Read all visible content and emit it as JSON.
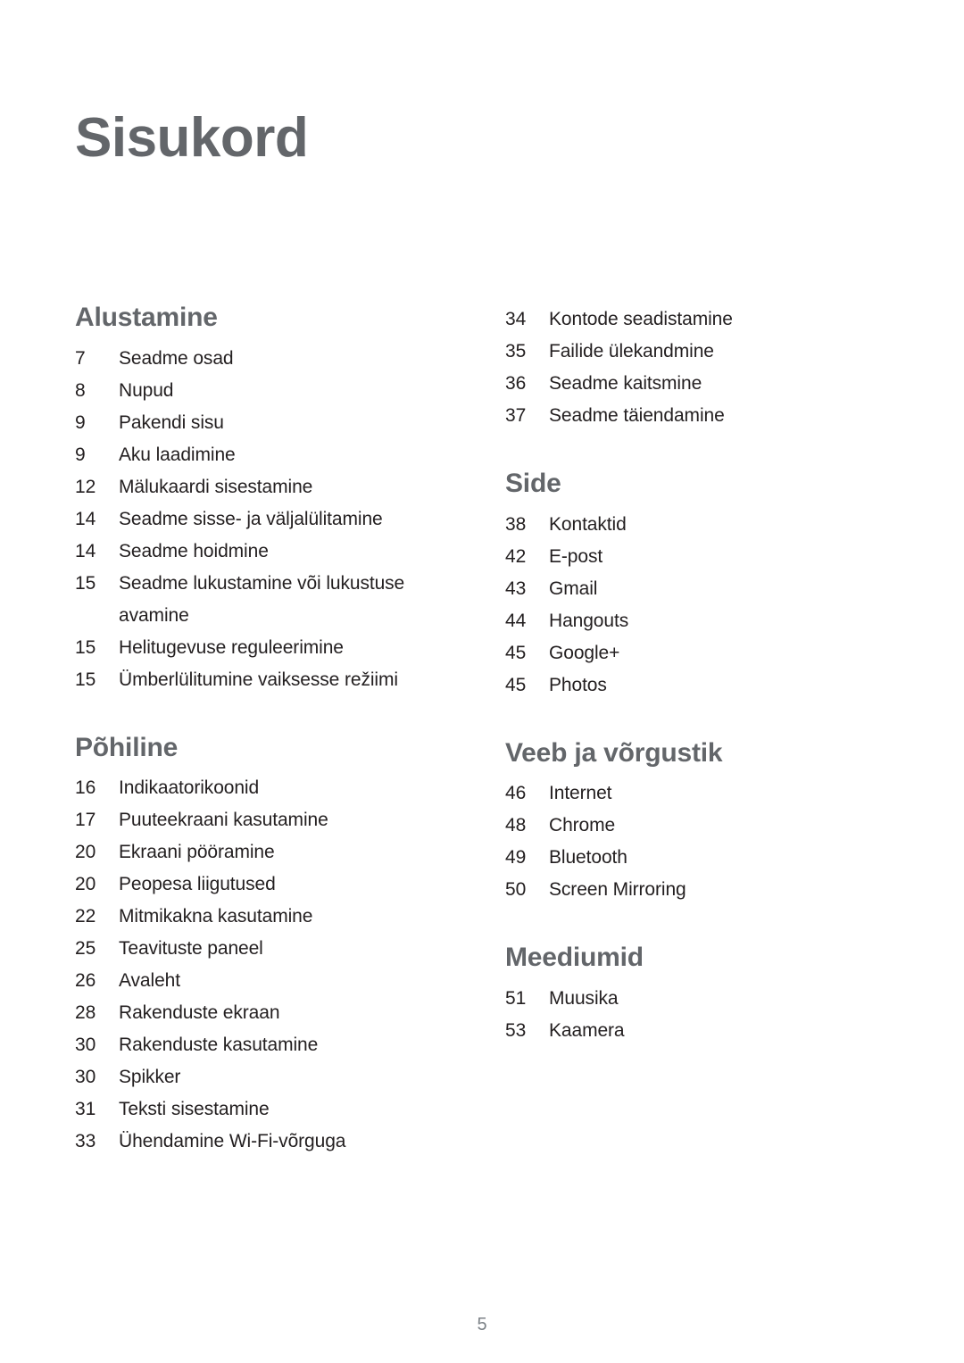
{
  "document": {
    "title": "Sisukord",
    "page_number": "5"
  },
  "colors": {
    "heading": "#63666a",
    "body_text": "#231f20",
    "folio": "#7c8287",
    "background": "#ffffff"
  },
  "columns": {
    "left": [
      {
        "heading": "Alustamine",
        "entries": [
          {
            "page": "7",
            "label": "Seadme osad"
          },
          {
            "page": "8",
            "label": "Nupud"
          },
          {
            "page": "9",
            "label": "Pakendi sisu"
          },
          {
            "page": "9",
            "label": "Aku laadimine"
          },
          {
            "page": "12",
            "label": "Mälukaardi sisestamine"
          },
          {
            "page": "14",
            "label": "Seadme sisse- ja väljalülitamine"
          },
          {
            "page": "14",
            "label": "Seadme hoidmine"
          },
          {
            "page": "15",
            "label": "Seadme lukustamine või lukustuse avamine"
          },
          {
            "page": "15",
            "label": "Helitugevuse reguleerimine"
          },
          {
            "page": "15",
            "label": "Ümberlülitumine vaiksesse režiimi"
          }
        ]
      },
      {
        "heading": "Põhiline",
        "entries": [
          {
            "page": "16",
            "label": "Indikaatorikoonid"
          },
          {
            "page": "17",
            "label": "Puuteekraani kasutamine"
          },
          {
            "page": "20",
            "label": "Ekraani pööramine"
          },
          {
            "page": "20",
            "label": "Peopesa liigutused"
          },
          {
            "page": "22",
            "label": "Mitmikakna kasutamine"
          },
          {
            "page": "25",
            "label": "Teavituste paneel"
          },
          {
            "page": "26",
            "label": "Avaleht"
          },
          {
            "page": "28",
            "label": "Rakenduste ekraan"
          },
          {
            "page": "30",
            "label": "Rakenduste kasutamine"
          },
          {
            "page": "30",
            "label": "Spikker"
          },
          {
            "page": "31",
            "label": "Teksti sisestamine"
          },
          {
            "page": "33",
            "label": "Ühendamine Wi-Fi-võrguga"
          }
        ]
      }
    ],
    "right": [
      {
        "heading": "",
        "entries": [
          {
            "page": "34",
            "label": "Kontode seadistamine"
          },
          {
            "page": "35",
            "label": "Failide ülekandmine"
          },
          {
            "page": "36",
            "label": "Seadme kaitsmine"
          },
          {
            "page": "37",
            "label": "Seadme täiendamine"
          }
        ]
      },
      {
        "heading": "Side",
        "entries": [
          {
            "page": "38",
            "label": "Kontaktid"
          },
          {
            "page": "42",
            "label": "E-post"
          },
          {
            "page": "43",
            "label": "Gmail"
          },
          {
            "page": "44",
            "label": "Hangouts"
          },
          {
            "page": "45",
            "label": "Google+"
          },
          {
            "page": "45",
            "label": "Photos"
          }
        ]
      },
      {
        "heading": "Veeb ja võrgustik",
        "entries": [
          {
            "page": "46",
            "label": "Internet"
          },
          {
            "page": "48",
            "label": "Chrome"
          },
          {
            "page": "49",
            "label": "Bluetooth"
          },
          {
            "page": "50",
            "label": "Screen Mirroring"
          }
        ]
      },
      {
        "heading": "Meediumid",
        "entries": [
          {
            "page": "51",
            "label": "Muusika"
          },
          {
            "page": "53",
            "label": "Kaamera"
          }
        ]
      }
    ]
  }
}
